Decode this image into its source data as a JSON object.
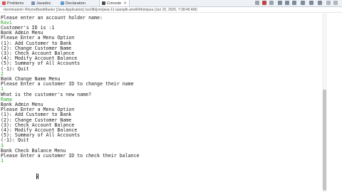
{
  "tabs": [
    {
      "label": "Problems",
      "icon": "problems-icon",
      "active": false
    },
    {
      "label": "Javadoc",
      "icon": "javadoc-icon",
      "active": false
    },
    {
      "label": "Declaration",
      "icon": "declaration-icon",
      "active": false
    },
    {
      "label": "Console",
      "icon": "console-icon",
      "active": true
    }
  ],
  "status_text": "<terminated> RhymeBankMaster [Java Application] /usr/lib/jvm/java-11-openjdk-amd64/bin/java (Jun 15, 2020, 7:38:46 AM)",
  "colors": {
    "input_text": "#2fa52f",
    "output_text": "#1a1a1a"
  },
  "console_lines": [
    {
      "text": "Please enter an account holder name:",
      "input": false
    },
    {
      "text": "Ravi",
      "input": true
    },
    {
      "text": "Customer's ID is :1",
      "input": false
    },
    {
      "text": "Bank Admin Menu",
      "input": false
    },
    {
      "text": "Please Enter a Menu Option",
      "input": false
    },
    {
      "text": "(1): Add Customer to Bank",
      "input": false
    },
    {
      "text": "(2): Change Customer Name",
      "input": false
    },
    {
      "text": "(3): Check Account Balance",
      "input": false
    },
    {
      "text": "(4): Modify Account Balance",
      "input": false
    },
    {
      "text": "(5): Summary of All Accounts",
      "input": false
    },
    {
      "text": "(-1): Quit",
      "input": false
    },
    {
      "text": "2",
      "input": true
    },
    {
      "text": "Bank Change Name Menu",
      "input": false
    },
    {
      "text": "Please Enter a customer ID to change their name",
      "input": false
    },
    {
      "text": "1",
      "input": true
    },
    {
      "text": "What is the customer's new name?",
      "input": false
    },
    {
      "text": "Rama",
      "input": true
    },
    {
      "text": "Bank Admin Menu",
      "input": false
    },
    {
      "text": "Please Enter a Menu Option",
      "input": false
    },
    {
      "text": "(1): Add Customer to Bank",
      "input": false
    },
    {
      "text": "(2): Change Customer Name",
      "input": false
    },
    {
      "text": "(3): Check Account Balance",
      "input": false
    },
    {
      "text": "(4): Modify Account Balance",
      "input": false
    },
    {
      "text": "(5): Summary of All Accounts",
      "input": false
    },
    {
      "text": "(-1): Quit",
      "input": false
    },
    {
      "text": "3",
      "input": true
    },
    {
      "text": "Bank Check Balance Menu",
      "input": false
    },
    {
      "text": "Please Enter a customer ID to check their balance",
      "input": false
    },
    {
      "text": "1",
      "input": true
    }
  ]
}
